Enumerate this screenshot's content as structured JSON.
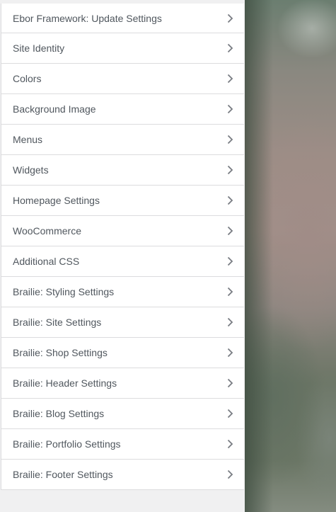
{
  "sidebar": {
    "items": [
      {
        "label": "Ebor Framework: Update Settings"
      },
      {
        "label": "Site Identity"
      },
      {
        "label": "Colors"
      },
      {
        "label": "Background Image"
      },
      {
        "label": "Menus"
      },
      {
        "label": "Widgets"
      },
      {
        "label": "Homepage Settings"
      },
      {
        "label": "WooCommerce"
      },
      {
        "label": "Additional CSS"
      },
      {
        "label": "Brailie: Styling Settings"
      },
      {
        "label": "Brailie: Site Settings"
      },
      {
        "label": "Brailie: Shop Settings"
      },
      {
        "label": "Brailie: Header Settings"
      },
      {
        "label": "Brailie: Blog Settings"
      },
      {
        "label": "Brailie: Portfolio Settings"
      },
      {
        "label": "Brailie: Footer Settings"
      }
    ],
    "item_icon": "chevron-right-icon",
    "text_color": "#50575e",
    "icon_color": "#787c82",
    "border_color": "#dcdcde",
    "background_color": "#f0f0f1"
  },
  "preview": {
    "description_icon": "site-preview-image"
  }
}
